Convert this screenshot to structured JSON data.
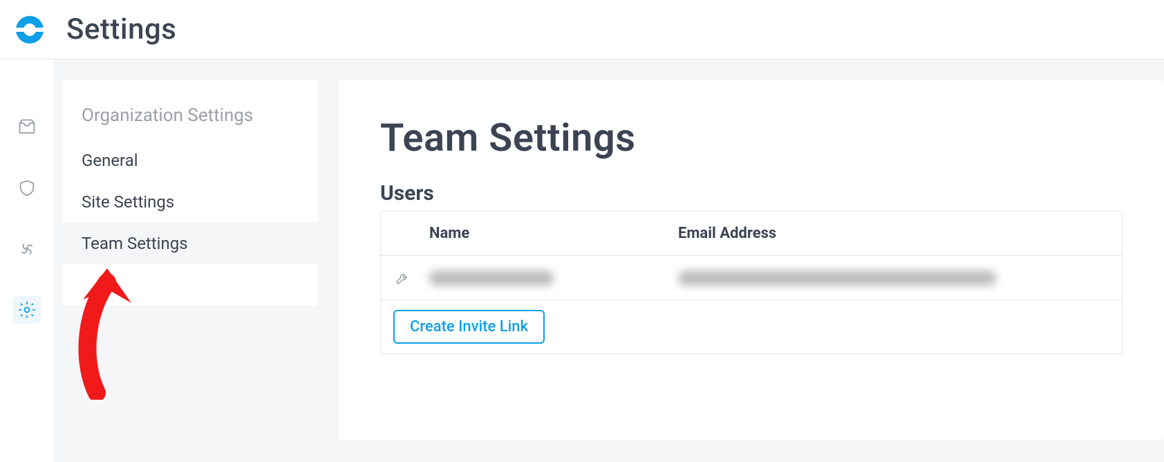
{
  "header": {
    "title": "Settings"
  },
  "nav": {
    "heading": "Organization Settings",
    "items": [
      {
        "label": "General"
      },
      {
        "label": "Site Settings"
      },
      {
        "label": "Team Settings",
        "active": true
      }
    ]
  },
  "main": {
    "title": "Team Settings",
    "users_section": {
      "heading": "Users",
      "columns": {
        "name": "Name",
        "email": "Email Address"
      },
      "rows": [
        {
          "name": "(redacted)",
          "email": "(redacted)"
        }
      ],
      "invite_button_label": "Create Invite Link"
    }
  },
  "colors": {
    "blue": "#0e9fe8",
    "arrow": "#f01a1a"
  },
  "rail_icons": [
    "inbox-icon",
    "shield-icon",
    "swirl-icon",
    "gear-icon"
  ],
  "active_rail_icon": "gear-icon"
}
